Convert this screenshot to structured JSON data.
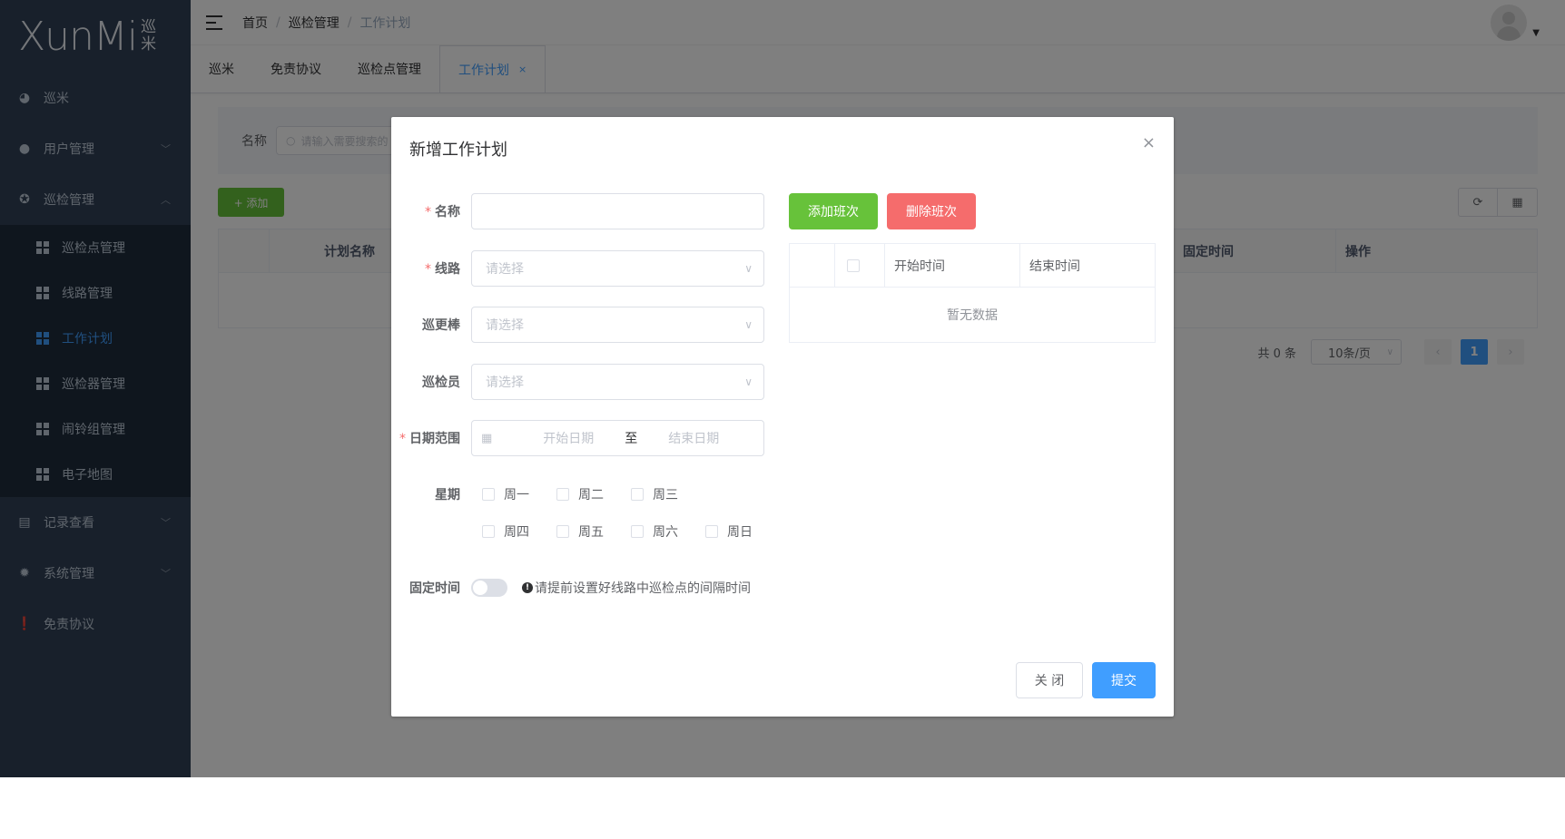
{
  "logo": {
    "text": "XunMi",
    "cn_top": "巡",
    "cn_bottom": "米"
  },
  "sidebar": {
    "items": [
      {
        "label": "巡米",
        "icon": "dashboard-icon"
      },
      {
        "label": "用户管理",
        "icon": "user-icon",
        "arrow": "chevron-down"
      },
      {
        "label": "巡检管理",
        "icon": "compass-icon",
        "arrow": "chevron-up"
      },
      {
        "label": "记录查看",
        "icon": "clipboard-icon",
        "arrow": "chevron-down"
      },
      {
        "label": "系统管理",
        "icon": "gear-icon",
        "arrow": "chevron-down"
      },
      {
        "label": "免责协议",
        "icon": "exclamation-icon"
      }
    ],
    "submenu": [
      {
        "label": "巡检点管理"
      },
      {
        "label": "线路管理"
      },
      {
        "label": "工作计划",
        "active": true
      },
      {
        "label": "巡检器管理"
      },
      {
        "label": "闹铃组管理"
      },
      {
        "label": "电子地图"
      }
    ]
  },
  "breadcrumb": [
    "首页",
    "巡检管理",
    "工作计划"
  ],
  "breadcrumb_sep": "/",
  "tags": [
    {
      "label": "巡米"
    },
    {
      "label": "免责协议"
    },
    {
      "label": "巡检点管理"
    },
    {
      "label": "工作计划",
      "active": true,
      "close": "×"
    }
  ],
  "search": {
    "label": "名称",
    "placeholder": "请输入需要搜索的"
  },
  "toolbar": {
    "add_label": "+ 添加",
    "refresh_icon": "⟳",
    "columns_icon": "▦"
  },
  "list_table": {
    "columns": [
      "",
      "计划名称",
      "",
      "",
      "",
      "",
      "固定时间",
      "操作"
    ]
  },
  "pagination": {
    "total": "共 0 条",
    "page_size": "10条/页",
    "prev": "‹",
    "current": "1",
    "next": "›"
  },
  "dialog": {
    "title": "新增工作计划",
    "close": "×",
    "fields": {
      "name": {
        "label": "名称",
        "required": true,
        "value": ""
      },
      "route": {
        "label": "线路",
        "required": true,
        "placeholder": "请选择"
      },
      "patrol_stick": {
        "label": "巡更棒",
        "required": false,
        "placeholder": "请选择"
      },
      "inspector": {
        "label": "巡检员",
        "required": false,
        "placeholder": "请选择"
      },
      "date_range": {
        "label": "日期范围",
        "required": true,
        "start_placeholder": "开始日期",
        "separator": "至",
        "end_placeholder": "结束日期"
      },
      "weekdays": {
        "label": "星期",
        "days": [
          "周一",
          "周二",
          "周三",
          "周四",
          "周五",
          "周六",
          "周日"
        ]
      },
      "fixed_time": {
        "label": "固定时间",
        "enabled": false,
        "hint": "请提前设置好线路中巡检点的间隔时间"
      }
    },
    "buttons": {
      "add_shift": "添加班次",
      "delete_shift": "删除班次",
      "close": "关 闭",
      "submit": "提交"
    },
    "shift_table": {
      "columns": [
        "",
        "",
        "开始时间",
        "结束时间"
      ],
      "empty": "暂无数据"
    }
  },
  "colors": {
    "sidebar": "#304156",
    "submenu": "#1f2d3d",
    "primary": "#409eff",
    "success": "#67c23a",
    "danger": "#f56c6c"
  }
}
